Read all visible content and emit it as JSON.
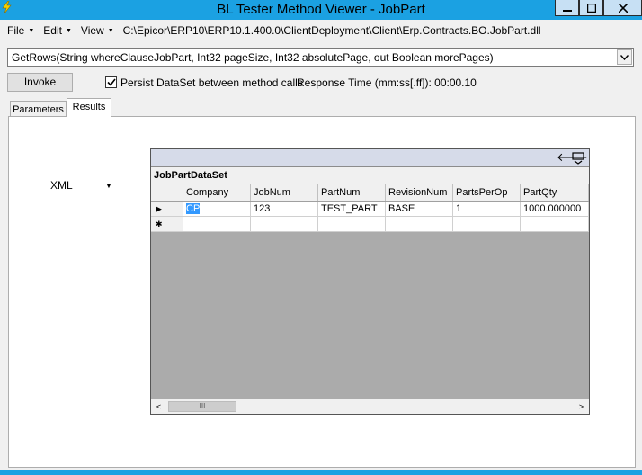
{
  "window": {
    "title": "BL Tester Method Viewer - JobPart"
  },
  "menu": {
    "items": [
      {
        "label": "File"
      },
      {
        "label": "Edit"
      },
      {
        "label": "View"
      }
    ],
    "dll_path": "C:\\Epicor\\ERP10\\ERP10.1.400.0\\ClientDeployment\\Client\\Erp.Contracts.BO.JobPart.dll"
  },
  "method": {
    "selected": "GetRows(String whereClauseJobPart, Int32 pageSize, Int32 absolutePage, out Boolean morePages)"
  },
  "toolbar": {
    "invoke_label": "Invoke",
    "persist_checked": true,
    "persist_label": "Persist DataSet between method calls",
    "response_time_label": "Response Time (mm:ss[.ff]): 00:00.10"
  },
  "tabs": [
    {
      "label": "Parameters",
      "active": false
    },
    {
      "label": "Results",
      "active": true
    }
  ],
  "results": {
    "format": "XML",
    "dataset_name": "JobPartDataSet",
    "columns": [
      "Company",
      "JobNum",
      "PartNum",
      "RevisionNum",
      "PartsPerOp",
      "PartQty"
    ],
    "rows": [
      [
        "CP",
        "123",
        "TEST_PART",
        "BASE",
        "1",
        "1000.000000"
      ]
    ],
    "scroll_thumb_glyph": "III"
  },
  "colors": {
    "titlebar": "#1ba1e2",
    "selection": "#3399ff",
    "grid_background": "#ababab"
  }
}
